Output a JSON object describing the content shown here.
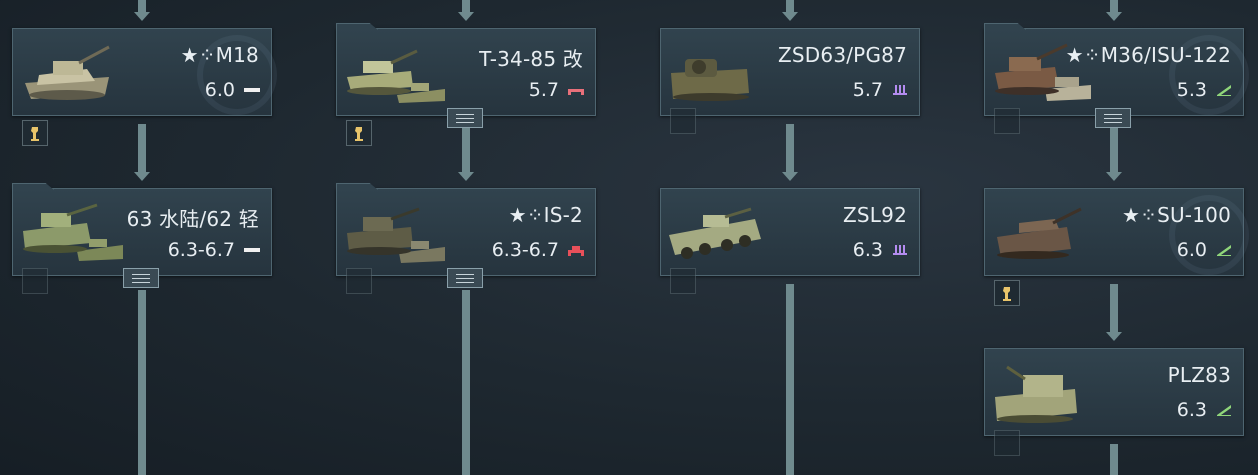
{
  "vehicles": [
    {
      "id": "m18",
      "name": "★⁘M18",
      "br": "6.0",
      "cls": "light"
    },
    {
      "id": "t3485",
      "name": "T-34-85 改",
      "br": "5.7",
      "cls": "medium"
    },
    {
      "id": "zsd63",
      "name": "ZSD63/PG87",
      "br": "5.7",
      "cls": "spaa"
    },
    {
      "id": "m36",
      "name": "★⁘M36/ISU-122",
      "br": "5.3",
      "cls": "td"
    },
    {
      "id": "type63",
      "name": "63 水陆/62 轻",
      "br": "6.3-6.7",
      "cls": "light"
    },
    {
      "id": "is2",
      "name": "★⁘IS-2",
      "br": "6.3-6.7",
      "cls": "heavy"
    },
    {
      "id": "zsl92",
      "name": "ZSL92",
      "br": "6.3",
      "cls": "spaa"
    },
    {
      "id": "su100",
      "name": "★⁘SU-100",
      "br": "6.0",
      "cls": "td"
    },
    {
      "id": "plz83",
      "name": "PLZ83",
      "br": "6.3",
      "cls": "td"
    }
  ],
  "colors": {
    "light": "#f0f0f0",
    "medium": "#e8707a",
    "heavy": "#e8505a",
    "spaa": "#b48cf0",
    "td": "#8fd67a",
    "line": "#6f8a8e",
    "card": "#2d3d48"
  }
}
